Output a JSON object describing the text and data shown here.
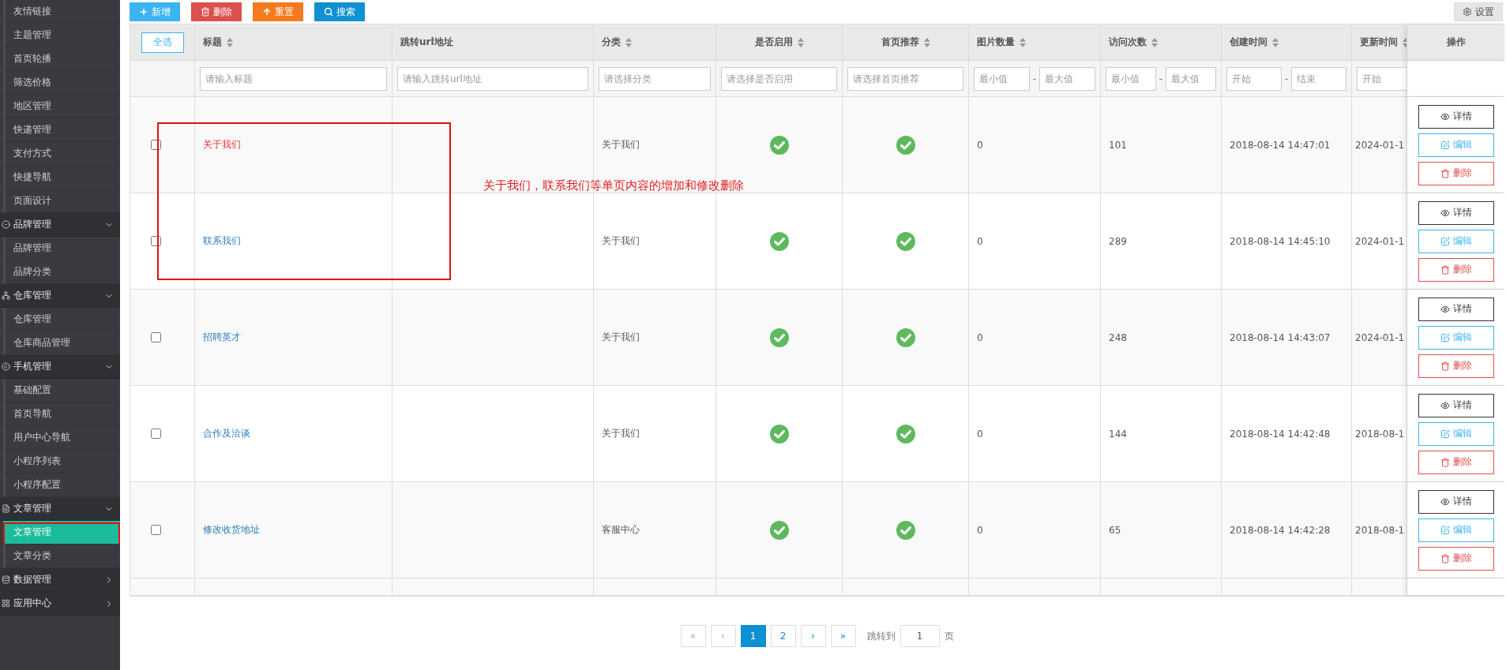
{
  "sidebar": [
    {
      "kind": "item",
      "label": "友情链接",
      "selected": false
    },
    {
      "kind": "item",
      "label": "主题管理",
      "selected": false
    },
    {
      "kind": "item",
      "label": "首页轮播",
      "selected": false
    },
    {
      "kind": "item",
      "label": "筛选价格",
      "selected": false
    },
    {
      "kind": "item",
      "label": "地区管理",
      "selected": false
    },
    {
      "kind": "item",
      "label": "快递管理",
      "selected": false
    },
    {
      "kind": "item",
      "label": "支付方式",
      "selected": false
    },
    {
      "kind": "item",
      "label": "快捷导航",
      "selected": false
    },
    {
      "kind": "item",
      "label": "页面设计",
      "selected": false
    },
    {
      "kind": "group",
      "label": "品牌管理",
      "expanded": true,
      "children": [
        {
          "label": "品牌管理",
          "selected": false
        },
        {
          "label": "品牌分类",
          "selected": false
        }
      ]
    },
    {
      "kind": "group",
      "label": "仓库管理",
      "expanded": true,
      "children": [
        {
          "label": "仓库管理",
          "selected": false
        },
        {
          "label": "仓库商品管理",
          "selected": false
        }
      ]
    },
    {
      "kind": "group",
      "label": "手机管理",
      "expanded": true,
      "children": [
        {
          "label": "基础配置",
          "selected": false
        },
        {
          "label": "首页导航",
          "selected": false
        },
        {
          "label": "用户中心导航",
          "selected": false
        },
        {
          "label": "小程序列表",
          "selected": false
        },
        {
          "label": "小程序配置",
          "selected": false
        }
      ]
    },
    {
      "kind": "group",
      "label": "文章管理",
      "expanded": true,
      "children": [
        {
          "label": "文章管理",
          "selected": true,
          "highlighted": true
        },
        {
          "label": "文章分类",
          "selected": false
        }
      ]
    },
    {
      "kind": "group",
      "label": "数据管理",
      "expanded": false
    },
    {
      "kind": "group",
      "label": "应用中心",
      "expanded": false
    }
  ],
  "toolbar": [
    {
      "kind": "add",
      "label": "新增"
    },
    {
      "kind": "delete",
      "label": "删除"
    },
    {
      "kind": "reset",
      "label": "重置"
    },
    {
      "kind": "search",
      "label": "搜索"
    }
  ],
  "settings_button": "设置",
  "table": {
    "select_all": "全选",
    "actions_header": "操作",
    "columns": [
      {
        "label": "标题",
        "sortable": true,
        "filter": {
          "kind": "text",
          "placeholder": "请输入标题"
        }
      },
      {
        "label": "跳转url地址",
        "sortable": false,
        "filter": {
          "kind": "text",
          "placeholder": "请输入跳转url地址"
        }
      },
      {
        "label": "分类",
        "sortable": true,
        "filter": {
          "kind": "text",
          "placeholder": "请选择分类"
        }
      },
      {
        "label": "是否启用",
        "sortable": true,
        "filter": {
          "kind": "text",
          "placeholder": "请选择是否启用"
        }
      },
      {
        "label": "首页推荐",
        "sortable": true,
        "filter": {
          "kind": "text",
          "placeholder": "请选择首页推荐"
        }
      },
      {
        "label": "图片数量",
        "sortable": true,
        "filter": {
          "kind": "range",
          "placeholders": [
            "最小值",
            "最大值"
          ],
          "separator": "-"
        }
      },
      {
        "label": "访问次数",
        "sortable": true,
        "filter": {
          "kind": "range",
          "placeholders": [
            "最小值",
            "最大值"
          ],
          "separator": "-"
        }
      },
      {
        "label": "创建时间",
        "sortable": true,
        "filter": {
          "kind": "range",
          "placeholders": [
            "开始",
            "结束"
          ],
          "separator": "-"
        }
      },
      {
        "label": "更新时间",
        "sortable": true,
        "filter": {
          "kind": "text",
          "placeholder": "开始"
        }
      }
    ],
    "rows": [
      {
        "checked": false,
        "title": "关于我们",
        "highlighted": true,
        "category": "关于我们",
        "enabled": true,
        "recommended": true,
        "images": "0",
        "visits": "101",
        "created": "2018-08-14 14:47:01",
        "updated": "2024-01-1",
        "actions": [
          {
            "kind": "view",
            "label": "详情"
          },
          {
            "kind": "edit",
            "label": "编辑"
          },
          {
            "kind": "delete",
            "label": "删除"
          }
        ]
      },
      {
        "checked": false,
        "title": "联系我们",
        "highlighted": false,
        "category": "关于我们",
        "enabled": true,
        "recommended": true,
        "images": "0",
        "visits": "289",
        "created": "2018-08-14 14:45:10",
        "updated": "2024-01-1",
        "actions": [
          {
            "kind": "view",
            "label": "详情"
          },
          {
            "kind": "edit",
            "label": "编辑"
          },
          {
            "kind": "delete",
            "label": "删除"
          }
        ]
      },
      {
        "checked": false,
        "title": "招聘英才",
        "highlighted": false,
        "category": "关于我们",
        "enabled": true,
        "recommended": true,
        "images": "0",
        "visits": "248",
        "created": "2018-08-14 14:43:07",
        "updated": "2024-01-1",
        "actions": [
          {
            "kind": "view",
            "label": "详情"
          },
          {
            "kind": "edit",
            "label": "编辑"
          },
          {
            "kind": "delete",
            "label": "删除"
          }
        ]
      },
      {
        "checked": false,
        "title": "合作及洽谈",
        "highlighted": false,
        "category": "关于我们",
        "enabled": true,
        "recommended": true,
        "images": "0",
        "visits": "144",
        "created": "2018-08-14 14:42:48",
        "updated": "2018-08-1",
        "actions": [
          {
            "kind": "view",
            "label": "详情"
          },
          {
            "kind": "edit",
            "label": "编辑"
          },
          {
            "kind": "delete",
            "label": "删除"
          }
        ]
      },
      {
        "checked": false,
        "title": "修改收货地址",
        "highlighted": false,
        "category": "客服中心",
        "enabled": true,
        "recommended": true,
        "images": "0",
        "visits": "65",
        "created": "2018-08-14 14:42:28",
        "updated": "2018-08-1",
        "actions": [
          {
            "kind": "view",
            "label": "详情"
          },
          {
            "kind": "edit",
            "label": "编辑"
          },
          {
            "kind": "delete",
            "label": "删除"
          }
        ]
      }
    ]
  },
  "pagination": {
    "pages": [
      {
        "label": "«",
        "disabled": true,
        "selected": false
      },
      {
        "label": "‹",
        "disabled": true,
        "selected": false
      },
      {
        "label": "1",
        "disabled": false,
        "selected": true
      },
      {
        "label": "2",
        "disabled": false,
        "selected": false
      },
      {
        "label": "›",
        "disabled": false,
        "selected": false
      },
      {
        "label": "»",
        "disabled": false,
        "selected": false
      }
    ],
    "jump_label": "跳转到",
    "jump_value": "1",
    "jump_suffix": "页"
  },
  "annotation": {
    "note": "关于我们，联系我们等单页内容的增加和修改删除"
  }
}
